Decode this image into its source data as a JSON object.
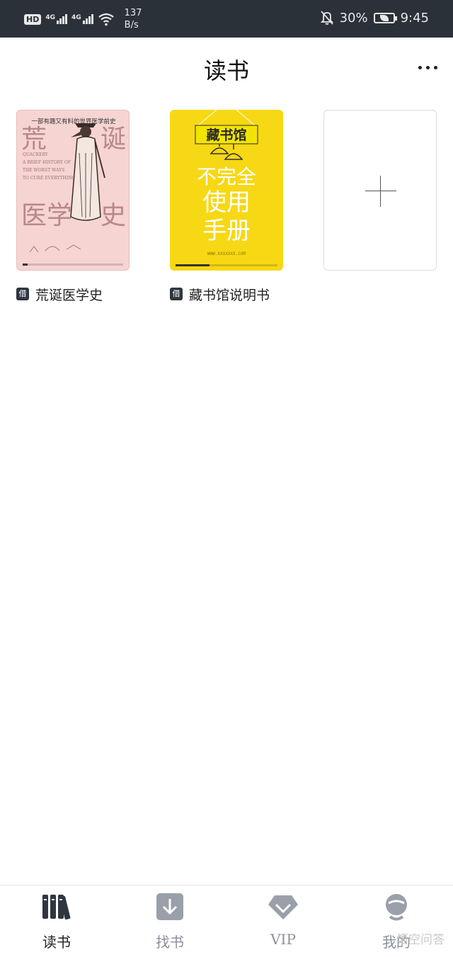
{
  "status_bar": {
    "hd": "HD",
    "network1": "4G",
    "network2": "4G",
    "speed_value": "137",
    "speed_unit": "B/s",
    "battery": "30%",
    "time": "9:45"
  },
  "header": {
    "title": "读书"
  },
  "books": [
    {
      "tag": "借",
      "title": "荒诞医学史",
      "progress": 0.05,
      "cover": {
        "top_line": "一部有趣又有料的世界医学前史",
        "big1": "荒",
        "big2": "诞",
        "big3": "医学",
        "big4": "史",
        "en": [
          "QUACKERY",
          "A BRIEF HISTORY OF",
          "THE WORST WAYS",
          "TO CURE EVERYTHING"
        ]
      }
    },
    {
      "tag": "借",
      "title": "藏书馆说明书",
      "progress": 0.33,
      "cover": {
        "sign": "藏书馆",
        "line1": "不完全",
        "line2": "使用",
        "line3": "手册",
        "url": "WWW.XXXXXXX.COM"
      }
    }
  ],
  "tabs": [
    {
      "label": "读书",
      "active": true
    },
    {
      "label": "找书",
      "active": false
    },
    {
      "label": "VIP",
      "active": false
    },
    {
      "label": "我的",
      "active": false
    }
  ],
  "watermark": "悟空问答",
  "colors": {
    "status_bar_bg": "#2b3139",
    "active_tab": "#2f3640",
    "inactive_tab": "#9aa0aa",
    "yellow_cover": "#f7d814",
    "pink_cover": "#f6d4d2"
  }
}
